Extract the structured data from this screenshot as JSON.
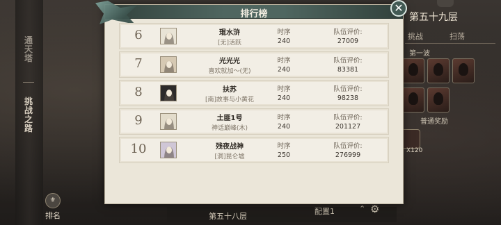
{
  "modal": {
    "title": "排行榜",
    "close_symbol": "✕"
  },
  "rows": [
    {
      "rank": "6",
      "name": "琨水浒",
      "guild": "[无]活跃",
      "seq_label": "时序",
      "seq": "240",
      "score_label": "队伍评价:",
      "score": "27009",
      "avatar_color": "#e9e4d6"
    },
    {
      "rank": "7",
      "name": "光光光",
      "guild": "喜欢就加～(无)",
      "seq_label": "时序",
      "seq": "240",
      "score_label": "队伍评价:",
      "score": "83381",
      "avatar_color": "#d6c9b3"
    },
    {
      "rank": "8",
      "name": "扶苏",
      "guild": "[南]故事与小黄花",
      "seq_label": "时序",
      "seq": "240",
      "score_label": "队伍评价:",
      "score": "98238",
      "avatar_color": "#2c2a2a"
    },
    {
      "rank": "9",
      "name": "土匪1号",
      "guild": "神话巅峰(木)",
      "seq_label": "时序",
      "seq": "240",
      "score_label": "队伍评价:",
      "score": "201127",
      "avatar_color": "#e3dccb"
    },
    {
      "rank": "10",
      "name": "残夜战神",
      "guild": "[洞]昆仑墟",
      "seq_label": "时序",
      "seq": "250",
      "score_label": "队伍评价:",
      "score": "276999",
      "avatar_color": "#cfc6d6"
    }
  ],
  "sidebar": {
    "tab1": "通天塔",
    "tab2": "挑战之路",
    "rank_button": "排名"
  },
  "right_panel": {
    "floor_title": "第五十九层",
    "tab_challenge": "挑战",
    "tab_sweep": "扫荡",
    "wave_label": "第一波",
    "reward_label": "普通奖励",
    "reward_count": "X120"
  },
  "bottom": {
    "floor": "第五十八层",
    "config": "配置1"
  }
}
